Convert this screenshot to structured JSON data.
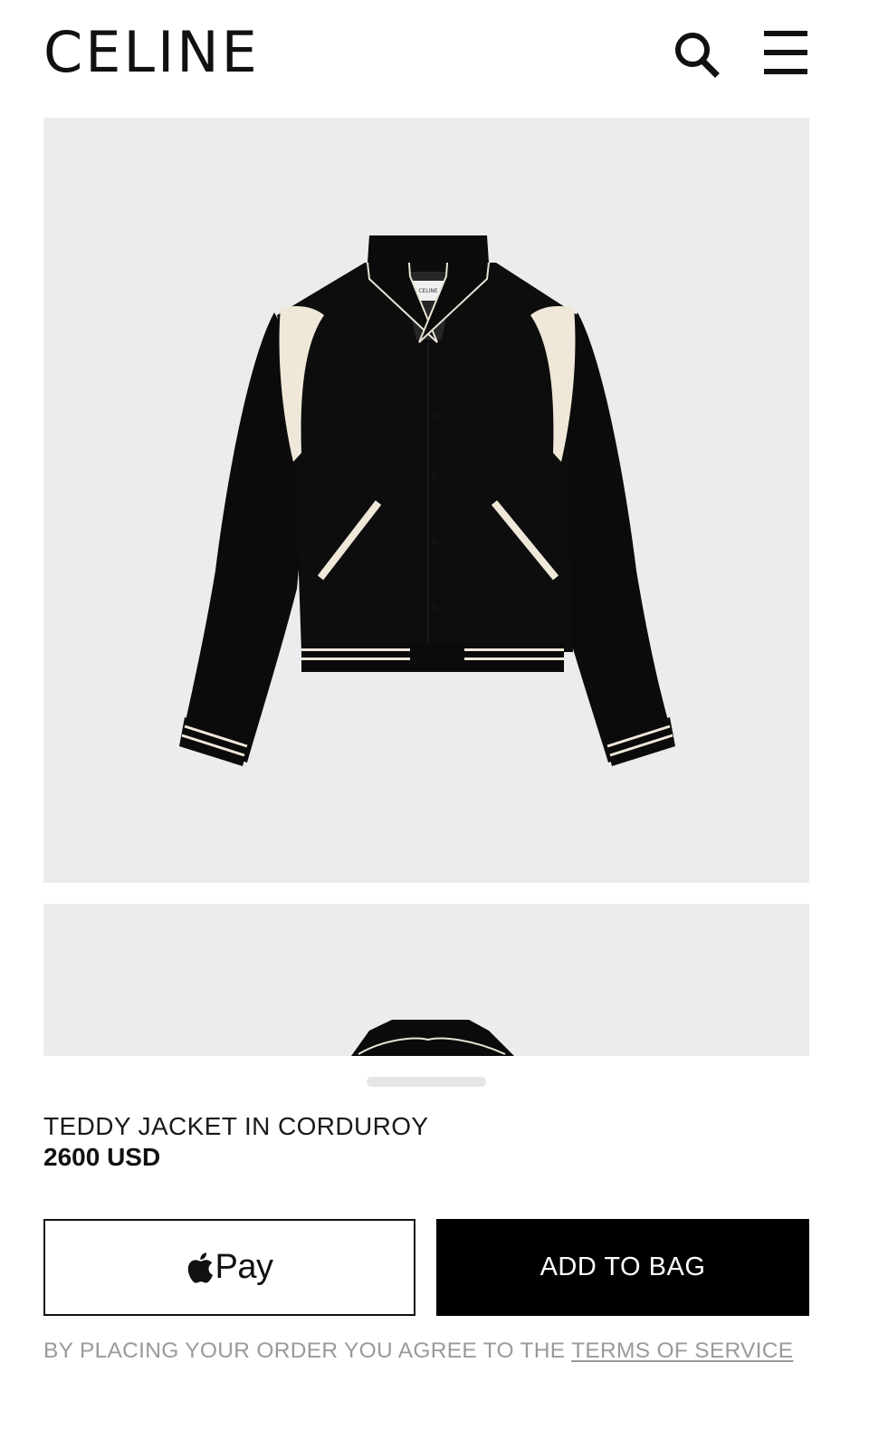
{
  "header": {
    "logo": "CELINE",
    "search_icon": "search-icon",
    "menu_icon": "menu-icon"
  },
  "gallery": {
    "images": [
      {
        "name": "jacket-front-image"
      },
      {
        "name": "jacket-detail-image"
      }
    ]
  },
  "product": {
    "name": "TEDDY JACKET IN CORDUROY",
    "price": "2600 USD"
  },
  "actions": {
    "apple_pay_label": "Pay",
    "apple_icon": "apple-icon",
    "add_to_bag_label": "ADD TO BAG"
  },
  "legal": {
    "text": "BY PLACING YOUR ORDER YOU AGREE TO THE ",
    "link": "TERMS OF SERVICE"
  },
  "colors": {
    "background": "#ffffff",
    "image_bg": "#ececec",
    "primary": "#000000",
    "muted_text": "#9a9a9a"
  }
}
